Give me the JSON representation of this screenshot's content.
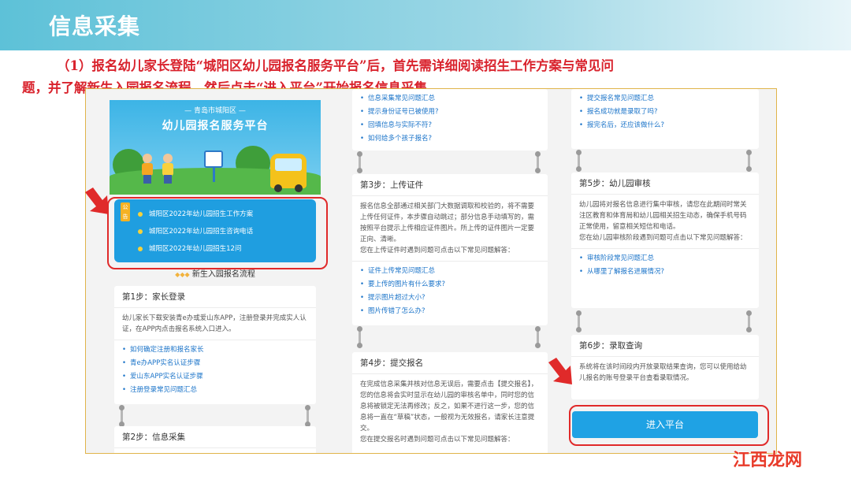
{
  "banner": {
    "title": "信息采集"
  },
  "intro": {
    "line1": "（1）报名幼儿家长登陆“城阳区幼儿园报名服务平台”后，首先需详细阅读招生工作方案与常见问",
    "line2": "题，并了解新生入园报名流程，然后点击“进入平台”开始报名信息采集。"
  },
  "hero": {
    "subtitle": "— 青岛市城阳区 —",
    "title": "幼儿园报名服务平台"
  },
  "notice": {
    "tag": "公告",
    "items": [
      "城阳区2022年幼儿园招生工作方案",
      "城阳区2022年幼儿园招生咨询电话",
      "城阳区2022年幼儿园招生12问"
    ]
  },
  "flow_title": "新生入园报名流程",
  "step1": {
    "title": "第1步：家长登录",
    "body": "幼儿家长下载安装青e办或爱山东APP，注册登录并完成实人认证，在APP内点击报名系统入口进入。",
    "links": [
      "如何确定注册和报名家长",
      "青e办APP实名认证步骤",
      "爱山东APP实名认证步骤",
      "注册登录常见问题汇总"
    ]
  },
  "step2": {
    "title": "第2步：信息采集"
  },
  "col2_top_links": [
    "信息采集常见问题汇总",
    "提示身份证号已被使用?",
    "回填信息与实际不符?",
    "如何给多个孩子报名?"
  ],
  "step3": {
    "title": "第3步：上传证件",
    "body": "报名信息全部通过相关部门大数据调取和校验的，将不需要上传任何证件，本步骤自动跳过；部分信息手动填写的，需按照平台提示上传相应证件图片。所上传的证件图片一定要正向、清晰。",
    "body2": "您在上传证件时遇到问题可点击以下常见问题解答：",
    "links": [
      "证件上传常见问题汇总",
      "要上传的图片有什么要求?",
      "提示图片超过大小?",
      "图片传错了怎么办?"
    ]
  },
  "step4": {
    "title": "第4步：提交报名",
    "body": "在完成信息采集并核对信息无误后，需要点击【提交报名】，您的信息将会实时显示在幼儿园的审核名单中，同时您的信息将被锁定无法再修改；反之，如果不进行这一步，您的信息将一直在“草稿”状态，一般视为无效报名，请家长注意提交。",
    "body2": "您在提交报名时遇到问题可点击以下常见问题解答："
  },
  "col3_top_links": [
    "提交报名常见问题汇总",
    "报名成功就是录取了吗?",
    "报完名后，还应该做什么?"
  ],
  "step5": {
    "title": "第5步：幼儿园审核",
    "body": "幼儿园将对报名信息进行集中审核，请您在此期间时常关注区教育和体育局和幼儿园相关招生动态，确保手机号码正常使用，留意相关短信和电话。",
    "body2": "您在幼儿园审核阶段遇到问题可点击以下常见问题解答：",
    "links": [
      "审核阶段常见问题汇总",
      "从哪里了解报名进展情况?"
    ]
  },
  "step6": {
    "title": "第6步：录取查询",
    "body": "系统将在该时间段内开放录取结果查询，您可以使用给幼儿报名的账号登录平台查看录取情况。"
  },
  "enter_button": "进入平台",
  "watermark": "江西龙网",
  "colors": {
    "accent": "#1fa2e4",
    "highlight": "#e02a2a",
    "intro_text": "#d9232d"
  }
}
